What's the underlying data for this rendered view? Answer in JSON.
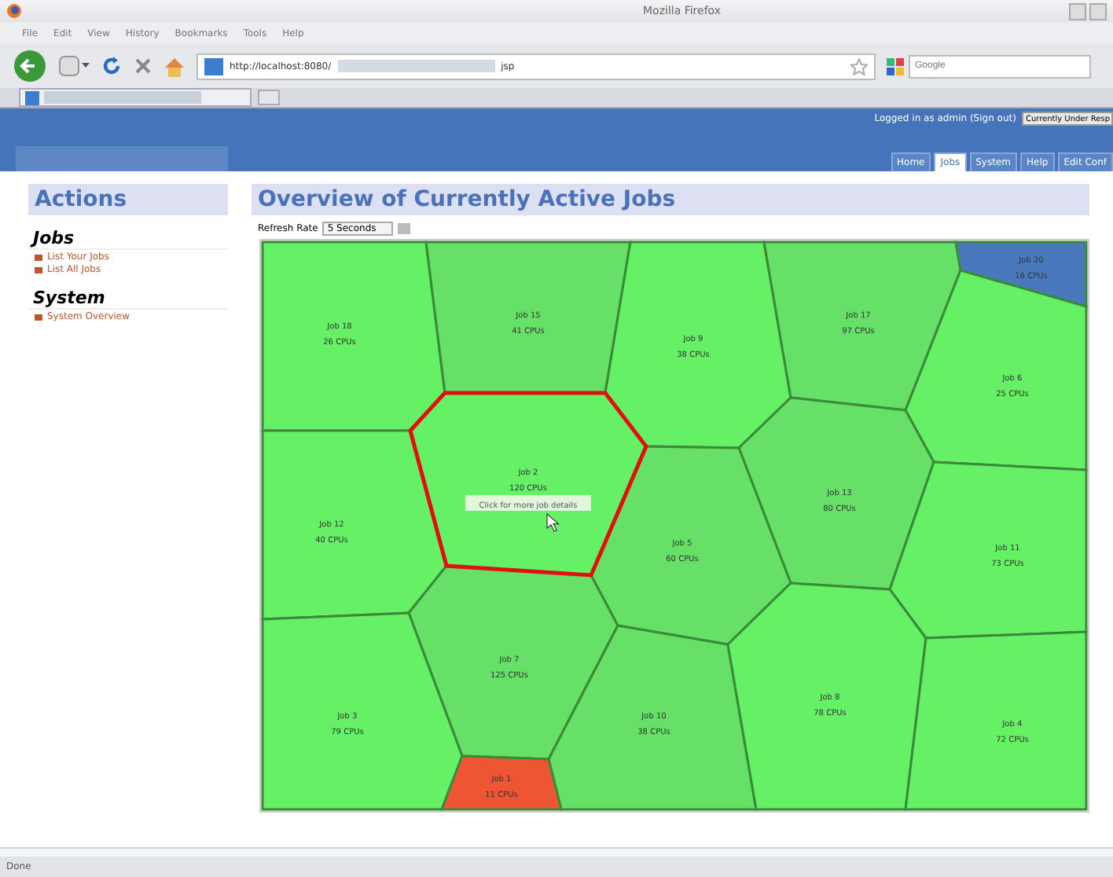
{
  "window": {
    "title": "Mozilla Firefox"
  },
  "menu": [
    "File",
    "Edit",
    "View",
    "History",
    "Bookmarks",
    "Tools",
    "Help"
  ],
  "address_bar": {
    "value": "http://localhost:8080/",
    "suffix": "jsp"
  },
  "search": {
    "placeholder": "Google"
  },
  "header": {
    "login_text": "Logged in as admin (Sign out)",
    "button": "Currently Under Resp"
  },
  "nav_tabs": [
    {
      "label": "Home",
      "selected": false
    },
    {
      "label": "Jobs",
      "selected": true
    },
    {
      "label": "System",
      "selected": false
    },
    {
      "label": "Help",
      "selected": false
    },
    {
      "label": "Edit Conf",
      "selected": false
    }
  ],
  "sidebar": {
    "title": "Actions",
    "sections": [
      {
        "heading": "Jobs",
        "links": [
          "List Your Jobs",
          "List All Jobs"
        ]
      },
      {
        "heading": "System",
        "links": [
          "System Overview"
        ]
      }
    ]
  },
  "main": {
    "title": "Overview of Currently Active Jobs",
    "refresh_label": "Refresh Rate",
    "refresh_value": "5 Seconds",
    "cells": [
      {
        "label": "Job 18",
        "cpus": "26 CPUs",
        "color": "#66f066",
        "selected": false
      },
      {
        "label": "Job 15",
        "cpus": "41 CPUs",
        "color": "#66e066",
        "selected": false
      },
      {
        "label": "Job 9",
        "cpus": "38 CPUs",
        "color": "#66f066",
        "selected": false
      },
      {
        "label": "Job 17",
        "cpus": "97 CPUs",
        "color": "#66e066",
        "selected": false
      },
      {
        "label": "Job 20",
        "cpus": "16 CPUs",
        "color": "#4a78bd",
        "selected": false
      },
      {
        "label": "Job 6",
        "cpus": "25 CPUs",
        "color": "#66f066",
        "selected": false
      },
      {
        "label": "Job 2",
        "cpus": "120 CPUs",
        "color": "#66f066",
        "selected": true,
        "tooltip": "Click for more job details"
      },
      {
        "label": "Job 12",
        "cpus": "40 CPUs",
        "color": "#66f066",
        "selected": false
      },
      {
        "label": "Job 13",
        "cpus": "80 CPUs",
        "color": "#66e066",
        "selected": false
      },
      {
        "label": "Job 5",
        "cpus": "60 CPUs",
        "color": "#66e066",
        "selected": false
      },
      {
        "label": "Job 11",
        "cpus": "73 CPUs",
        "color": "#66f066",
        "selected": false
      },
      {
        "label": "Job 7",
        "cpus": "125 CPUs",
        "color": "#66e066",
        "selected": false
      },
      {
        "label": "Job 3",
        "cpus": "79 CPUs",
        "color": "#66f066",
        "selected": false
      },
      {
        "label": "Job 10",
        "cpus": "38 CPUs",
        "color": "#66e066",
        "selected": false
      },
      {
        "label": "Job 8",
        "cpus": "78 CPUs",
        "color": "#66f066",
        "selected": false
      },
      {
        "label": "Job 4",
        "cpus": "72 CPUs",
        "color": "#66f066",
        "selected": false
      },
      {
        "label": "Job 1",
        "cpus": "11 CPUs",
        "color": "#ee5533",
        "selected": false
      }
    ]
  },
  "status_bar": {
    "text": "Done"
  }
}
